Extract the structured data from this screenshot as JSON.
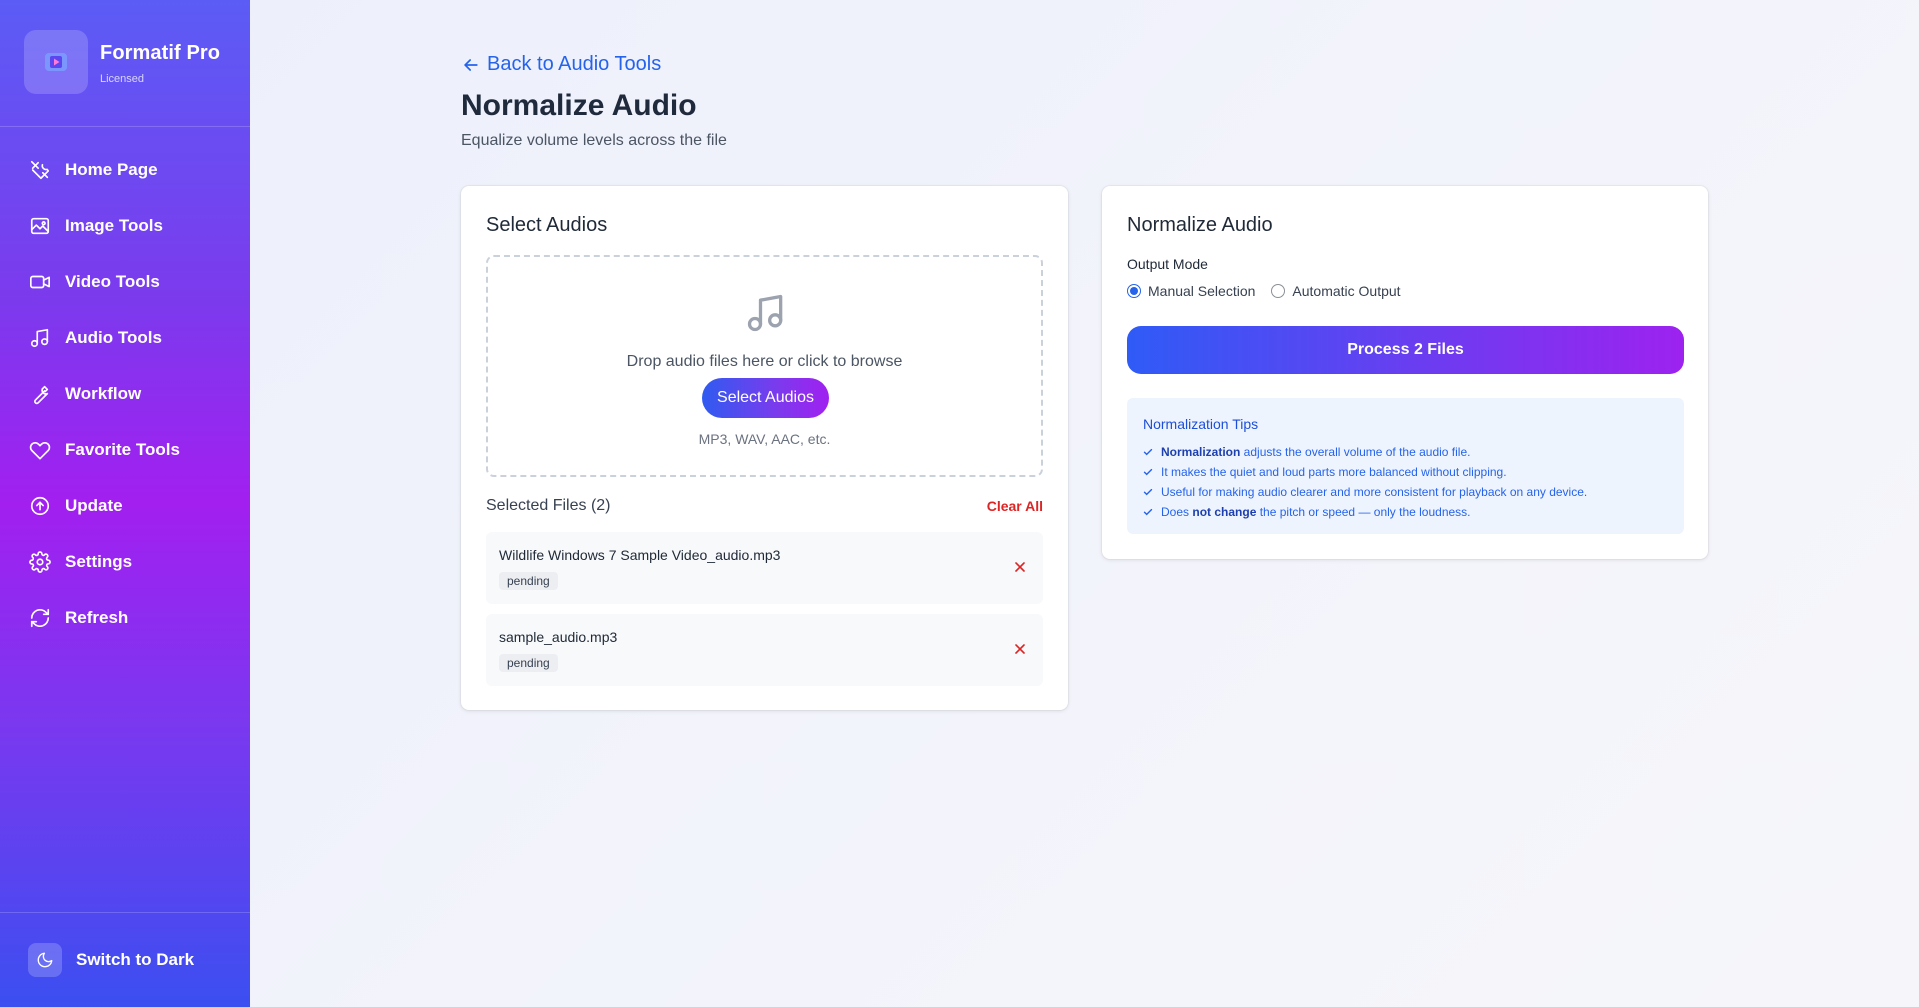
{
  "app": {
    "name": "Formatif Pro",
    "license": "Licensed"
  },
  "sidebar": {
    "items": [
      {
        "label": "Home Page",
        "icon": "tools-icon"
      },
      {
        "label": "Image Tools",
        "icon": "image-icon"
      },
      {
        "label": "Video Tools",
        "icon": "video-icon"
      },
      {
        "label": "Audio Tools",
        "icon": "music-icon"
      },
      {
        "label": "Workflow",
        "icon": "wrench-icon"
      },
      {
        "label": "Favorite Tools",
        "icon": "heart-icon"
      },
      {
        "label": "Update",
        "icon": "upload-icon"
      },
      {
        "label": "Settings",
        "icon": "gear-icon"
      },
      {
        "label": "Refresh",
        "icon": "refresh-icon"
      }
    ],
    "theme_toggle": "Switch to Dark"
  },
  "header": {
    "back": "Back to Audio Tools",
    "title": "Normalize Audio",
    "subtitle": "Equalize volume levels across the file"
  },
  "select": {
    "title": "Select Audios",
    "drop_text": "Drop audio files here or click to browse",
    "button": "Select Audios",
    "formats": "MP3, WAV, AAC, etc.",
    "selected_label": "Selected Files (2)",
    "clear_all": "Clear All",
    "files": [
      {
        "name": "Wildlife Windows 7 Sample Video_audio.mp3",
        "status": "pending"
      },
      {
        "name": "sample_audio.mp3",
        "status": "pending"
      }
    ]
  },
  "normalize": {
    "title": "Normalize Audio",
    "output_mode_label": "Output Mode",
    "modes": [
      {
        "label": "Manual Selection",
        "selected": true
      },
      {
        "label": "Automatic Output",
        "selected": false
      }
    ],
    "process_button": "Process 2 Files",
    "tips": {
      "title": "Normalization Tips",
      "t1_bold": "Normalization",
      "t1_rest": " adjusts the overall volume of the audio file.",
      "t2": "It makes the quiet and loud parts more balanced without clipping.",
      "t3": "Useful for making audio clearer and more consistent for playback on any device.",
      "t4_pre": "Does ",
      "t4_bold": "not change",
      "t4_rest": " the pitch or speed — only the loudness."
    }
  },
  "colors": {
    "accent": "#2563eb",
    "danger": "#dc2626",
    "sidebar_mid": "#a21ff0"
  }
}
